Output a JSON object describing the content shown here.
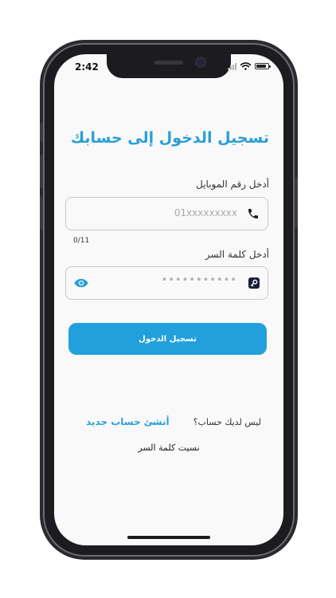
{
  "status_bar": {
    "time": "2:42"
  },
  "login": {
    "title": "تسجيل الدخول إلى حسابك",
    "mobile_label": "أدخل رقم الموبايل",
    "mobile_placeholder": "01xxxxxxxxx",
    "mobile_counter": "0/11",
    "password_label": "أدخل كلمة السر",
    "password_placeholder": "•••••••••••",
    "submit_label": "تسجيل الدخول",
    "no_account_text": "ليس لديك حساب؟",
    "create_account_link": "أنشئ حساب جديد",
    "forgot_password": "نسيت كلمة السر"
  },
  "icons": {
    "mobile_field": "phone-icon",
    "password_field": "key-icon",
    "toggle_visibility": "eye-icon"
  },
  "colors": {
    "accent": "#2a9fd6",
    "button": "#22a0dc",
    "border": "#c8c8c8",
    "background": "#f9f9f9"
  }
}
